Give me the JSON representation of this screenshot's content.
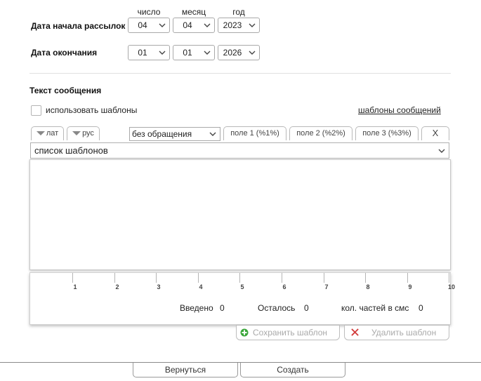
{
  "date_columns": {
    "day": "число",
    "month": "месяц",
    "year": "год"
  },
  "start_date": {
    "label": "Дата начала рассылок",
    "day": "04",
    "month": "04",
    "year": "2023"
  },
  "end_date": {
    "label": "Дата окончания",
    "day": "01",
    "month": "01",
    "year": "2026"
  },
  "message": {
    "heading": "Текст сообщения",
    "use_templates_label": "использовать шаблоны",
    "templates_link": "шаблоны сообщений",
    "tabs": {
      "lat": "лат",
      "rus": "рус",
      "salutation": "без обращения",
      "field1": "поле 1 (%1%)",
      "field2": "поле 2 (%2%)",
      "field3": "поле 3 (%3%)",
      "clear": "X"
    },
    "template_list": "список шаблонов",
    "text_value": ""
  },
  "ruler": {
    "ticks": [
      "1",
      "2",
      "3",
      "4",
      "5",
      "6",
      "7",
      "8",
      "9",
      "10"
    ]
  },
  "stats": {
    "entered_label": "Введено",
    "entered_value": "0",
    "remaining_label": "Осталось",
    "remaining_value": "0",
    "parts_label": "кол. частей в смс",
    "parts_value": "0"
  },
  "template_actions": {
    "save": "Сохранить шаблон",
    "delete": "Удалить шаблон"
  },
  "footer": {
    "back": "Вернуться",
    "create": "Создать"
  },
  "colors": {
    "save_icon": "#3aa63a",
    "delete_icon": "#d23c3c"
  }
}
